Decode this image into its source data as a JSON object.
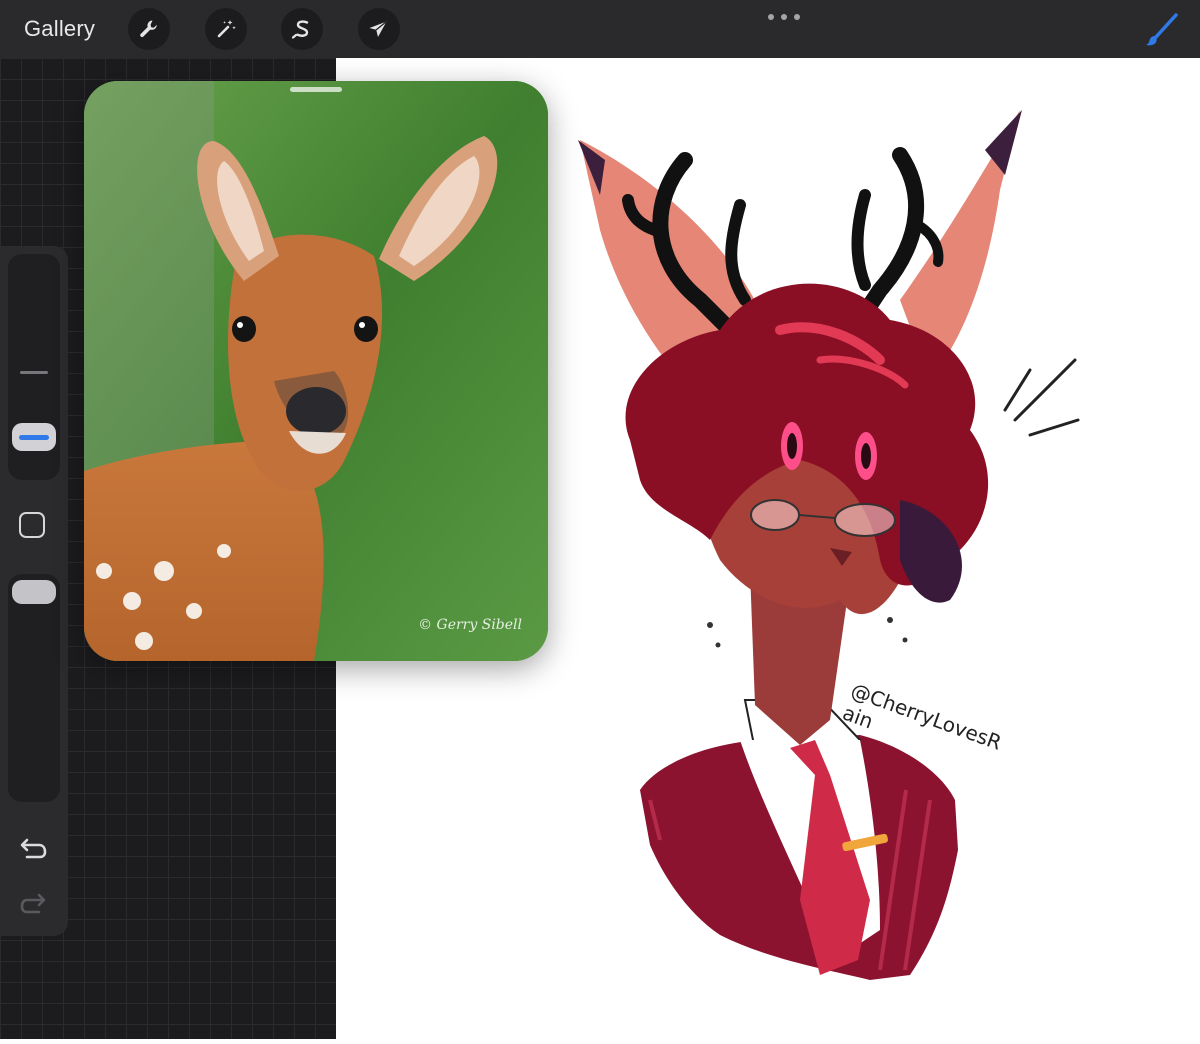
{
  "toolbar": {
    "gallery_label": "Gallery",
    "tools": [
      "wrench-icon",
      "magic-wand-icon",
      "selection-s-icon",
      "transform-arrow-icon"
    ],
    "more_icon": "more-dots-icon",
    "active_tool_icon": "brush-icon",
    "accent_color": "#2f79e8"
  },
  "sidebar": {
    "brush_size_level": 0.25,
    "opacity_level": 0.95,
    "modify_icon": "square-modify-icon",
    "undo_icon": "undo-icon",
    "redo_icon": "redo-icon"
  },
  "reference": {
    "watermark": "© Gerry Sibell",
    "background_color": "#4a8a35"
  },
  "canvas": {
    "signature": "@CherryLovesRain",
    "background_color": "#ffffff"
  }
}
